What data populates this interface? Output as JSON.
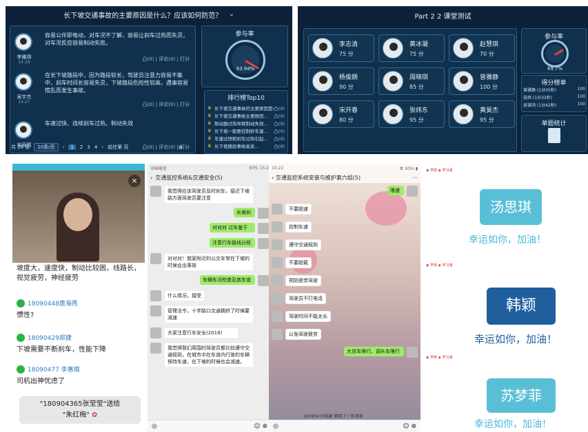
{
  "panel1": {
    "title": "长下坡交通事故的主要原因是什么？应该如何防范？",
    "chevron": "⌄",
    "posts": [
      {
        "name": "李雅琪",
        "time": "14:28",
        "text": "容易公伴即电动，对车况不了解，容易让刹车过热而失灵，对车况反应容易制动失败。",
        "actions": "凸(0) | 评论(0) | 打分"
      },
      {
        "name": "吴宇杰",
        "time": "14:27",
        "text": "在长下坡路段中，因为路段较长，驾驶员注意力容易不集中，刹车时间长容易失灵，下坡路段危险性较高，遇事容易慌乱而发生事故。",
        "actions": "凸(0) | 评论(0) | 打分"
      },
      {
        "name": "宋雨晴",
        "time": "14:27",
        "text": "车速过快、连续刹车过热、制动失效",
        "actions": "凸(0) | 评论(0) | 打分"
      }
    ],
    "participation_title": "参与率",
    "participation_value": "93.94%",
    "rank_title": "排行榜Top10",
    "rank_items": [
      "长下坡交通事故的主要原因是什么...",
      "长下坡交通事故主要原因...",
      "制动器过热导致制动失效...",
      "长下坡一般要控制好车速...",
      "车速过快和刹车过热引起...",
      "长下坡路段事故高发..."
    ],
    "rank_like": "凸(0)",
    "pager": {
      "total": "共 26 条",
      "size": "10条/页",
      "pages": [
        "1",
        "2",
        "3",
        "4"
      ],
      "current": "1",
      "goto": "前往第 页",
      "next": "»"
    }
  },
  "panel2": {
    "title": "Part 2 2 课堂测试",
    "students": [
      {
        "name": "李志清",
        "score": "75 分"
      },
      {
        "name": "黄冰凝",
        "score": "75 分"
      },
      {
        "name": "赵慧琪",
        "score": "70 分"
      },
      {
        "name": "杨俊朗",
        "score": "90 分"
      },
      {
        "name": "周晓琪",
        "score": "85 分"
      },
      {
        "name": "曾雅静",
        "score": "100 分"
      },
      {
        "name": "宋开春",
        "score": "80 分"
      },
      {
        "name": "张炜东",
        "score": "95 分"
      },
      {
        "name": "黄昊杰",
        "score": "95 分"
      }
    ],
    "end_button": "结束",
    "next": "»",
    "participation_title": "参与率",
    "participation_value": "89.7%",
    "score_title": "得分榜单",
    "score_items": [
      {
        "name": "曾雅静 (1分05秒)",
        "score": "100"
      },
      {
        "name": "张炜 (1分33秒)",
        "score": "100"
      },
      {
        "name": "吴锦鸿 (1分42秒)",
        "score": "100"
      }
    ],
    "single_stats": "单题统计"
  },
  "panel3": {
    "close": "×",
    "intro_text": "坡度大，速度快，制动比较困，线路长，视觉疲劳，神经疲劳",
    "comments": [
      {
        "user": "18090448唐海燕",
        "text": "惯性?"
      },
      {
        "user": "18090429郑捷",
        "text": "下坡需要不断刹车，性能下降"
      },
      {
        "user": "18090477 李惠瑜",
        "text": "司机出神忧虑了"
      }
    ],
    "gift_line1": "\"180904365张莹莹\"送给",
    "gift_line2": "\"朱红梅\""
  },
  "panel4": {
    "status_left": "中国电信",
    "status_right": "93%  15:2",
    "title": "交通监控系统&交通安全(5)",
    "messages": [
      {
        "side": "l",
        "text": "我觉得应该驾驶员及时刹车，接近下坡路方面驾驶员要注意"
      },
      {
        "side": "r",
        "text": "长坡刹"
      },
      {
        "side": "r",
        "text": "对对对 过车鉴于"
      },
      {
        "side": "r",
        "text": "注意行车路线分段"
      },
      {
        "side": "l",
        "text": "对对对！我家附近的公交车常在下坡的时候会出事故"
      },
      {
        "side": "r",
        "text": "车辆车况检查及其车道"
      },
      {
        "side": "l",
        "text": "什么情况，接受"
      },
      {
        "side": "l",
        "text": "管理法令，十字路口交通拥挤了时候要减速"
      },
      {
        "side": "l",
        "text": "大家注意行车安全(2018)"
      },
      {
        "side": "l",
        "text": "我觉得我们周围的驾驶员都比较遵守交通规则，在城市中在车道内行驶的车辆保持车速，在下坡的时候也会减速。"
      }
    ],
    "input_hint": "◎"
  },
  "panel5": {
    "status_time": "15:22",
    "status_right": "本 93% ▮",
    "title": "交通监控系统安装与维护第六组(5)",
    "more": "···",
    "messages": [
      {
        "side": "r",
        "text": "限速"
      },
      {
        "side": "l",
        "text": "不要超速"
      },
      {
        "side": "l",
        "text": "控制车速"
      },
      {
        "side": "l",
        "text": "遵守交通规则"
      },
      {
        "side": "l",
        "text": "不要超载"
      },
      {
        "side": "l",
        "text": "预防疲劳驾驶"
      },
      {
        "side": "l",
        "text": "驾驶员不打电话"
      },
      {
        "side": "l",
        "text": "驾驶时间不能太长"
      },
      {
        "side": "l",
        "text": "以免驾驶疲劳"
      },
      {
        "side": "r",
        "text": "大货车限行、调头车限行"
      }
    ],
    "footer_text": "18090433张颖 撤回了一条消息"
  },
  "panel6": {
    "logo": "◉ 学校 ◉ 学习通",
    "cards": [
      {
        "name": "汤思琪",
        "wish": "幸运如你，加油！"
      },
      {
        "name": "韩颖",
        "wish": "幸运如你，加油！"
      },
      {
        "name": "苏梦菲",
        "wish": "幸运如你，加油！"
      }
    ]
  }
}
